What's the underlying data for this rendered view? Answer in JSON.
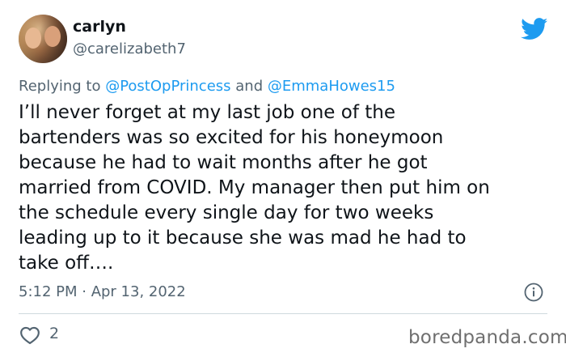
{
  "user": {
    "name": "carlyn",
    "handle": "@carelizabeth7"
  },
  "reply": {
    "prefix": "Replying to ",
    "mention1": "@PostOpPrincess",
    "conjunction": " and ",
    "mention2": "@EmmaHowes15"
  },
  "tweet": {
    "text": "I’ll never forget at my last job one of the\nbartenders was so excited for his honeymoon\nbecause he had to wait months after he got\nmarried from COVID. My manager then put him on\nthe schedule every single day for two weeks\nleading up to it because she was mad he had to\ntake off…."
  },
  "meta": {
    "timestamp": "5:12 PM · Apr 13, 2022"
  },
  "actions": {
    "like_count": "2"
  },
  "watermark": "boredpanda.com",
  "colors": {
    "twitter_blue": "#1d9bf0",
    "secondary_text": "#536471",
    "primary_text": "#0f1419"
  }
}
